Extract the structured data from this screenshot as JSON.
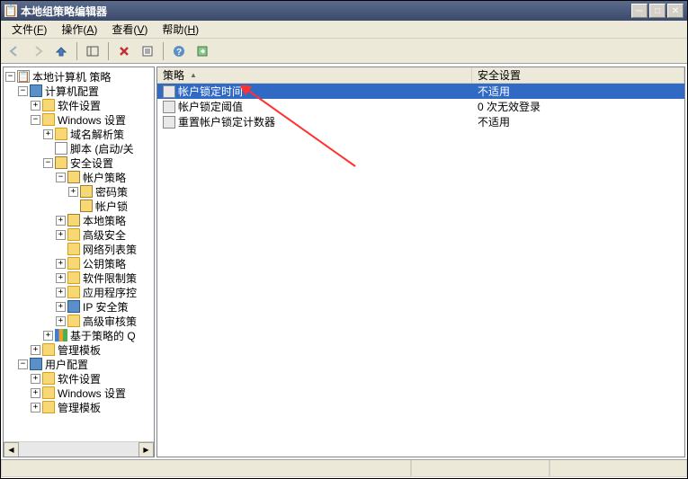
{
  "window": {
    "title": "本地组策略编辑器"
  },
  "menubar": [
    {
      "label": "文件",
      "accel": "F"
    },
    {
      "label": "操作",
      "accel": "A"
    },
    {
      "label": "查看",
      "accel": "V"
    },
    {
      "label": "帮助",
      "accel": "H"
    }
  ],
  "tree": {
    "root": {
      "label": "本地计算机 策略"
    },
    "computer_config": {
      "label": "计算机配置"
    },
    "software_settings": {
      "label": "软件设置"
    },
    "windows_settings": {
      "label": "Windows 设置"
    },
    "name_resolution": {
      "label": "域名解析策"
    },
    "scripts": {
      "label": "脚本 (启动/关"
    },
    "security_settings": {
      "label": "安全设置"
    },
    "account_policies": {
      "label": "帐户策略"
    },
    "password_policy": {
      "label": "密码策"
    },
    "account_lockout": {
      "label": "帐户锁"
    },
    "local_policies": {
      "label": "本地策略"
    },
    "advanced_security": {
      "label": "高级安全"
    },
    "network_list": {
      "label": "网络列表策"
    },
    "public_key": {
      "label": "公钥策略"
    },
    "software_restrict": {
      "label": "软件限制策"
    },
    "app_control": {
      "label": "应用程序控"
    },
    "ip_security": {
      "label": "IP 安全策"
    },
    "advanced_audit": {
      "label": "高级审核策"
    },
    "policy_based_q": {
      "label": "基于策略的 Q"
    },
    "admin_templates": {
      "label": "管理模板"
    },
    "user_config": {
      "label": "用户配置"
    },
    "user_software": {
      "label": "软件设置"
    },
    "user_windows": {
      "label": "Windows 设置"
    },
    "user_admin_templates": {
      "label": "管理模板"
    }
  },
  "list": {
    "columns": {
      "policy": "策略",
      "security_setting": "安全设置"
    },
    "rows": [
      {
        "policy": "帐户锁定时间",
        "setting": "不适用",
        "selected": true
      },
      {
        "policy": "帐户锁定阈值",
        "setting": "0 次无效登录",
        "selected": false
      },
      {
        "policy": "重置帐户锁定计数器",
        "setting": "不适用",
        "selected": false
      }
    ]
  }
}
